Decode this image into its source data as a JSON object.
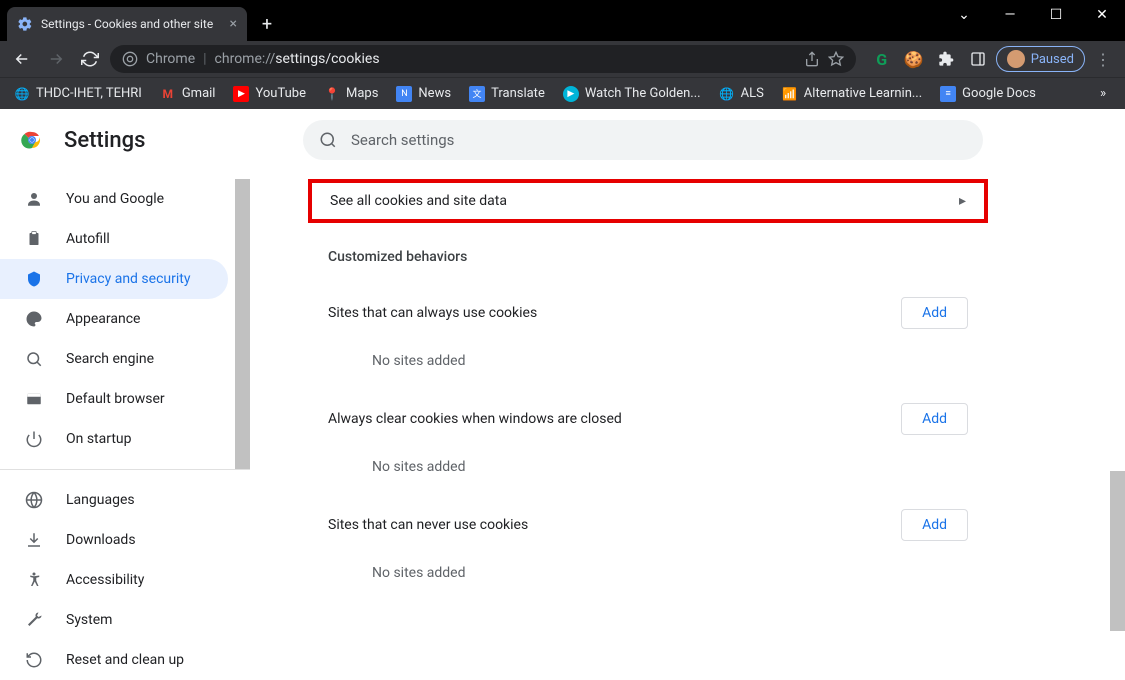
{
  "window": {
    "tab_title": "Settings - Cookies and other site",
    "tab_close": "×"
  },
  "address": {
    "secure_label": "Chrome",
    "url_prefix": "chrome://",
    "url_path": "settings/cookies"
  },
  "profile": {
    "status": "Paused"
  },
  "bookmarks": [
    {
      "label": "THDC-IHET, TEHRI"
    },
    {
      "label": "Gmail"
    },
    {
      "label": "YouTube"
    },
    {
      "label": "Maps"
    },
    {
      "label": "News"
    },
    {
      "label": "Translate"
    },
    {
      "label": "Watch The Golden..."
    },
    {
      "label": "ALS"
    },
    {
      "label": "Alternative Learnin..."
    },
    {
      "label": "Google Docs"
    }
  ],
  "app_title": "Settings",
  "search_placeholder": "Search settings",
  "sidebar": [
    {
      "label": "You and Google"
    },
    {
      "label": "Autofill"
    },
    {
      "label": "Privacy and security"
    },
    {
      "label": "Appearance"
    },
    {
      "label": "Search engine"
    },
    {
      "label": "Default browser"
    },
    {
      "label": "On startup"
    },
    {
      "label": "Languages"
    },
    {
      "label": "Downloads"
    },
    {
      "label": "Accessibility"
    },
    {
      "label": "System"
    },
    {
      "label": "Reset and clean up"
    }
  ],
  "main": {
    "see_all": "See all cookies and site data",
    "custom_title": "Customized behaviors",
    "add_label": "Add",
    "sections": [
      {
        "title": "Sites that can always use cookies",
        "empty": "No sites added"
      },
      {
        "title": "Always clear cookies when windows are closed",
        "empty": "No sites added"
      },
      {
        "title": "Sites that can never use cookies",
        "empty": "No sites added"
      }
    ]
  }
}
